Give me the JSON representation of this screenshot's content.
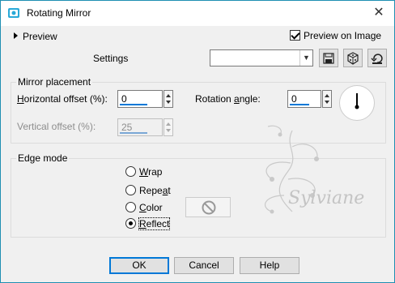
{
  "window": {
    "title": "Rotating Mirror"
  },
  "preview": {
    "toggle_label": "Preview",
    "checkbox_label": "Preview on Image",
    "checked": true
  },
  "settings": {
    "label": "Settings",
    "value": ""
  },
  "mirror": {
    "group_title": "Mirror placement",
    "h_offset": {
      "label_u": "H",
      "label_rest": "orizontal offset (%):",
      "value": "0"
    },
    "v_offset": {
      "label": "Vertical offset (%):",
      "value": "25"
    },
    "rotation": {
      "label_a": "Rotation ",
      "label_u": "a",
      "label_rest": "ngle:",
      "value": "0"
    }
  },
  "edge": {
    "group_title": "Edge mode",
    "options": [
      {
        "u": "W",
        "rest": "rap",
        "selected": false
      },
      {
        "u": "",
        "rest": "Repe",
        "u2": "a",
        "rest2": "t",
        "selected": false
      },
      {
        "u": "C",
        "rest": "olor",
        "selected": false
      },
      {
        "u": "R",
        "rest": "eflect",
        "selected": true
      }
    ]
  },
  "watermark": {
    "text": "Sylviane"
  },
  "buttons": {
    "ok": "OK",
    "cancel": "Cancel",
    "help": "Help"
  },
  "colors": {
    "accent": "#0078d7",
    "border": "#1f8fb2"
  }
}
